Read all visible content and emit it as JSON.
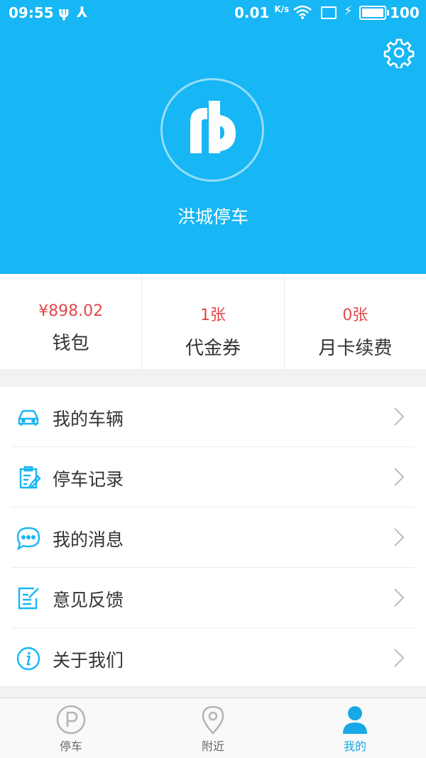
{
  "status_bar": {
    "time": "09:55",
    "net_speed": "0.01",
    "net_speed_unit": "K/s",
    "battery": "100"
  },
  "header": {
    "app_name": "洪城停车",
    "settings_icon": "gear-icon",
    "logo_icon": "parking-logo-icon"
  },
  "stats": [
    {
      "value": "¥898.02",
      "label": "钱包"
    },
    {
      "value": "1张",
      "label": "代金券"
    },
    {
      "value": "0张",
      "label": "月卡续费"
    }
  ],
  "menu": [
    {
      "label": "我的车辆",
      "icon": "car-icon"
    },
    {
      "label": "停车记录",
      "icon": "clipboard-edit-icon"
    },
    {
      "label": "我的消息",
      "icon": "chat-bubble-icon"
    },
    {
      "label": "意见反馈",
      "icon": "feedback-edit-icon"
    },
    {
      "label": "关于我们",
      "icon": "info-icon"
    }
  ],
  "tabs": [
    {
      "label": "停车",
      "icon": "parking-p-icon",
      "active": false
    },
    {
      "label": "附近",
      "icon": "location-pin-icon",
      "active": false
    },
    {
      "label": "我的",
      "icon": "user-icon",
      "active": true
    }
  ],
  "colors": {
    "accent": "#17b6f4",
    "value_red": "#e0494b",
    "tab_active": "#17a9e6"
  }
}
